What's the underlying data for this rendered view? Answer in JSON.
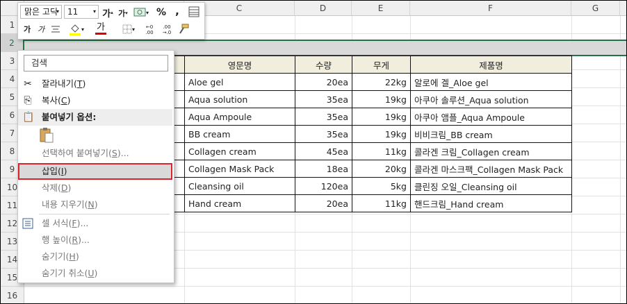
{
  "columns": [
    "C",
    "D",
    "E",
    "F",
    "G"
  ],
  "rows": [
    "1",
    "2",
    "3",
    "4",
    "5",
    "6",
    "7",
    "8",
    "9",
    "10",
    "11",
    "12",
    "13",
    "14",
    "15",
    "16"
  ],
  "mini_toolbar": {
    "font_name": "맑은 고딕",
    "font_size": "11",
    "grow_font": "가",
    "shrink_font": "가",
    "percent": "%",
    "comma": ",",
    "bold": "가",
    "italic": "가",
    "font_color_glyph": "가",
    "inc_decimal": ".00 →.0",
    "dec_decimal": ".00 →.0"
  },
  "context_menu": {
    "search_placeholder": "검색",
    "items": [
      {
        "label": "잘라내기",
        "key": "T"
      },
      {
        "label": "복사",
        "key": "C"
      },
      {
        "label": "붙여넣기 옵션:"
      },
      {
        "label": "선택하여 붙여넣기",
        "key": "S",
        "suffix": "..."
      },
      {
        "label": "삽입",
        "key": "I"
      },
      {
        "label": "삭제",
        "key": "D"
      },
      {
        "label": "내용 지우기",
        "key": "N"
      },
      {
        "label": "셀 서식",
        "key": "F",
        "suffix": "..."
      },
      {
        "label": "행 높이",
        "key": "R",
        "suffix": "..."
      },
      {
        "label": "숨기기",
        "key": "H"
      },
      {
        "label": "숨기기 취소",
        "key": "U"
      }
    ]
  },
  "table": {
    "headers": [
      "영문명",
      "수량",
      "무게",
      "제품명"
    ],
    "rows": [
      [
        "Aloe gel",
        "20ea",
        "22kg",
        "알로에 겔_Aloe gel"
      ],
      [
        "Aqua solution",
        "35ea",
        "19kg",
        "아쿠아 솔루션_Aqua solution"
      ],
      [
        "Aqua Ampoule",
        "35ea",
        "19kg",
        "아쿠아 앰플_Aqua Ampoule"
      ],
      [
        "BB cream",
        "35ea",
        "19kg",
        "비비크림_BB cream"
      ],
      [
        "Collagen cream",
        "45ea",
        "11kg",
        "콜라겐 크림_Collagen cream"
      ],
      [
        "Collagen Mask Pack",
        "18ea",
        "20kg",
        "콜라겐 마스크팩_Collagen Mask Pack"
      ],
      [
        "Cleansing oil",
        "120ea",
        "5kg",
        "클린징 오일_Cleansing oil"
      ],
      [
        "Hand cream",
        "20ea",
        "11kg",
        "핸드크림_Hand cream"
      ]
    ]
  },
  "colors": {
    "accent": "#217346",
    "highlight_border": "#d9232f",
    "header_fill": "#f1eedd"
  }
}
